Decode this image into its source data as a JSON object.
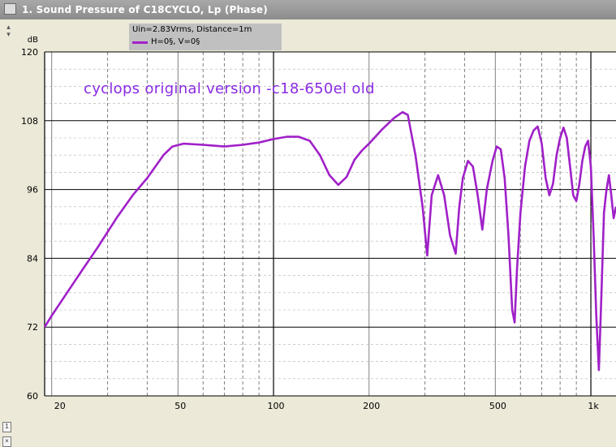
{
  "window": {
    "title": "1. Sound Pressure of C18CYCLO, Lp (Phase)",
    "icon": "graph-window-icon"
  },
  "annotation": "cyclops original version -c18-650el old",
  "colors": {
    "curve": "#a020c8",
    "annotation": "#8a2be2",
    "plot_bg": "#ffffff",
    "frame_bg": "#ece9d8",
    "legend_bg": "#c0c0c0"
  },
  "chart_data": {
    "type": "line",
    "title": "Sound Pressure of C18CYCLO, Lp (Phase)",
    "ylabel": "dB",
    "xlabel": "",
    "x_scale": "log",
    "xlim": [
      19,
      1200
    ],
    "ylim": [
      60,
      120
    ],
    "y_ticks": [
      "120",
      "108",
      "96",
      "84",
      "72",
      "60"
    ],
    "x_ticks": [
      {
        "value": 20,
        "label": "20"
      },
      {
        "value": 50,
        "label": "50"
      },
      {
        "value": 100,
        "label": "100"
      },
      {
        "value": 200,
        "label": "200"
      },
      {
        "value": 500,
        "label": "500"
      },
      {
        "value": 1000,
        "label": "1k"
      }
    ],
    "legend": {
      "conditions": "Uin=2.83Vrms, Distance=1m",
      "entry": "H=0§, V=0§"
    },
    "grid": true,
    "series": [
      {
        "name": "H=0§, V=0§",
        "points": [
          [
            19,
            72
          ],
          [
            20,
            74
          ],
          [
            23,
            79
          ],
          [
            25,
            82
          ],
          [
            28,
            86
          ],
          [
            32,
            91
          ],
          [
            36,
            95
          ],
          [
            40,
            98
          ],
          [
            45,
            102
          ],
          [
            48,
            103.5
          ],
          [
            52,
            104
          ],
          [
            60,
            103.8
          ],
          [
            70,
            103.5
          ],
          [
            80,
            103.8
          ],
          [
            90,
            104.2
          ],
          [
            100,
            104.8
          ],
          [
            110,
            105.2
          ],
          [
            120,
            105.2
          ],
          [
            130,
            104.5
          ],
          [
            140,
            102
          ],
          [
            150,
            98.5
          ],
          [
            160,
            96.8
          ],
          [
            170,
            98.2
          ],
          [
            180,
            101.2
          ],
          [
            190,
            102.8
          ],
          [
            200,
            104
          ],
          [
            220,
            106.5
          ],
          [
            240,
            108.5
          ],
          [
            255,
            109.5
          ],
          [
            265,
            109
          ],
          [
            280,
            102
          ],
          [
            295,
            93
          ],
          [
            305,
            84.5
          ],
          [
            315,
            95
          ],
          [
            330,
            98.5
          ],
          [
            345,
            95
          ],
          [
            360,
            88
          ],
          [
            375,
            84.8
          ],
          [
            385,
            93
          ],
          [
            395,
            98
          ],
          [
            410,
            101
          ],
          [
            425,
            100
          ],
          [
            440,
            95
          ],
          [
            455,
            89
          ],
          [
            470,
            96
          ],
          [
            490,
            101
          ],
          [
            505,
            103.5
          ],
          [
            520,
            103
          ],
          [
            535,
            98
          ],
          [
            550,
            88
          ],
          [
            565,
            75
          ],
          [
            575,
            72.8
          ],
          [
            585,
            82
          ],
          [
            600,
            92
          ],
          [
            620,
            100
          ],
          [
            640,
            104.5
          ],
          [
            660,
            106.3
          ],
          [
            680,
            107
          ],
          [
            700,
            104
          ],
          [
            720,
            98
          ],
          [
            740,
            95
          ],
          [
            760,
            97
          ],
          [
            780,
            102
          ],
          [
            800,
            105
          ],
          [
            820,
            106.8
          ],
          [
            840,
            105
          ],
          [
            860,
            100
          ],
          [
            880,
            95
          ],
          [
            900,
            94
          ],
          [
            920,
            97
          ],
          [
            940,
            101
          ],
          [
            960,
            103.5
          ],
          [
            980,
            104.5
          ],
          [
            1000,
            100
          ],
          [
            1020,
            88
          ],
          [
            1040,
            74
          ],
          [
            1060,
            64.5
          ],
          [
            1080,
            78
          ],
          [
            1100,
            92
          ],
          [
            1120,
            96
          ],
          [
            1140,
            98.5
          ],
          [
            1160,
            95
          ],
          [
            1180,
            91
          ],
          [
            1200,
            93
          ]
        ]
      }
    ]
  }
}
